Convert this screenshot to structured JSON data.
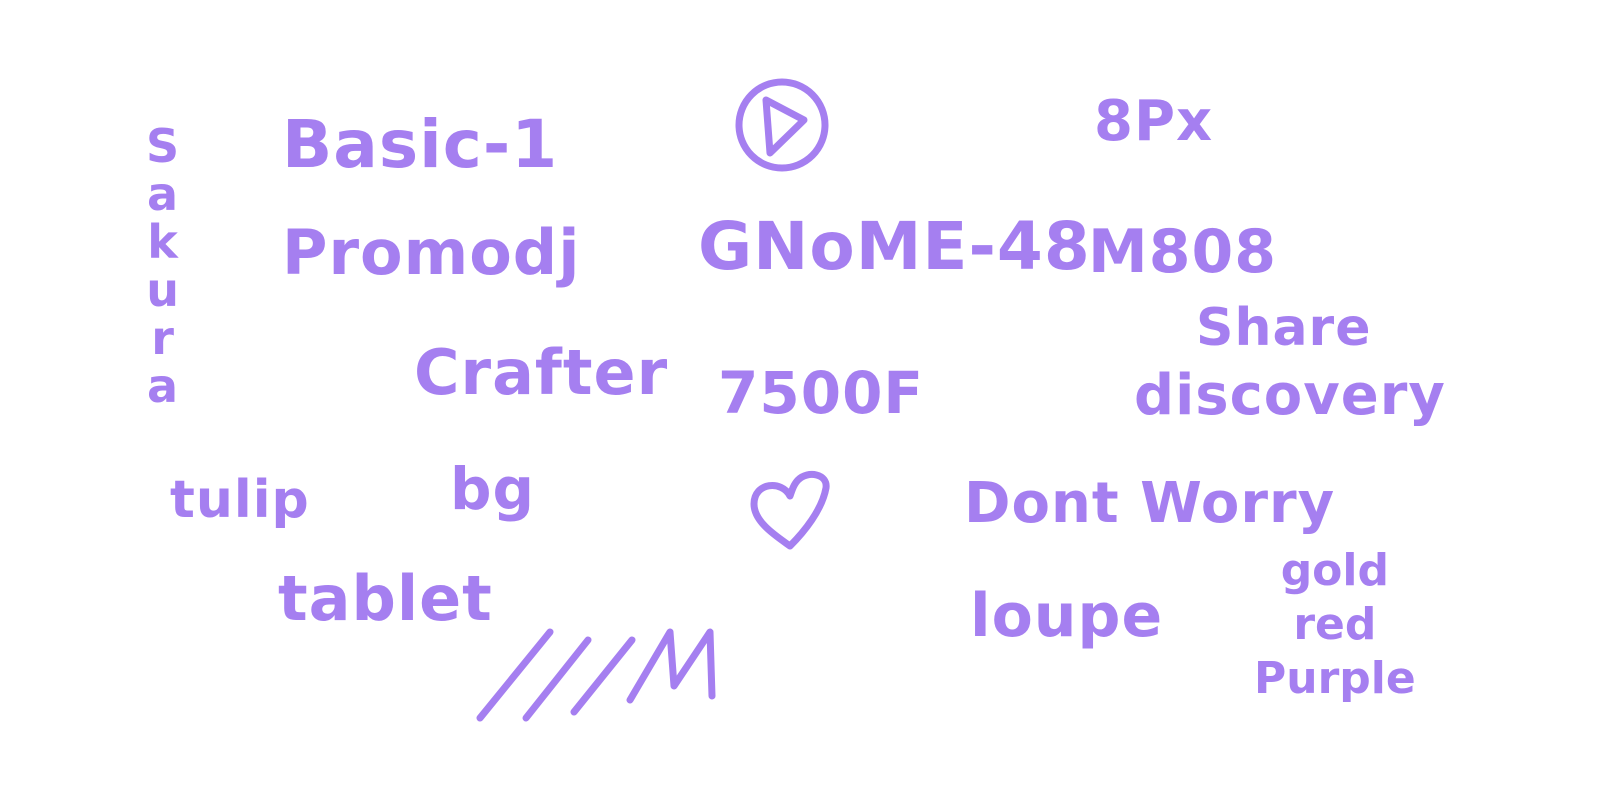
{
  "canvas": {
    "background": "#ffffff",
    "ink_color": "#a57ff0"
  },
  "words": {
    "sakura": [
      "S",
      "a",
      "k",
      "u",
      "r",
      "a"
    ],
    "basic": "Basic-1",
    "promodj": "Promodj",
    "crafter": "Crafter",
    "gnome": "GNoME-48",
    "code": "7500F",
    "px": "8Px",
    "m808": "M808",
    "share": "Share",
    "discovery": "discovery",
    "tulip": "tulip",
    "bg": "bg",
    "dont_worry": "Dont Worry",
    "tablet": "tablet",
    "loupe": "loupe",
    "colors": [
      "gold",
      "red",
      "Purple"
    ]
  },
  "icons": {
    "play": "play-circle-icon",
    "heart": "heart-icon",
    "strokes": "hatch-strokes-icon"
  }
}
